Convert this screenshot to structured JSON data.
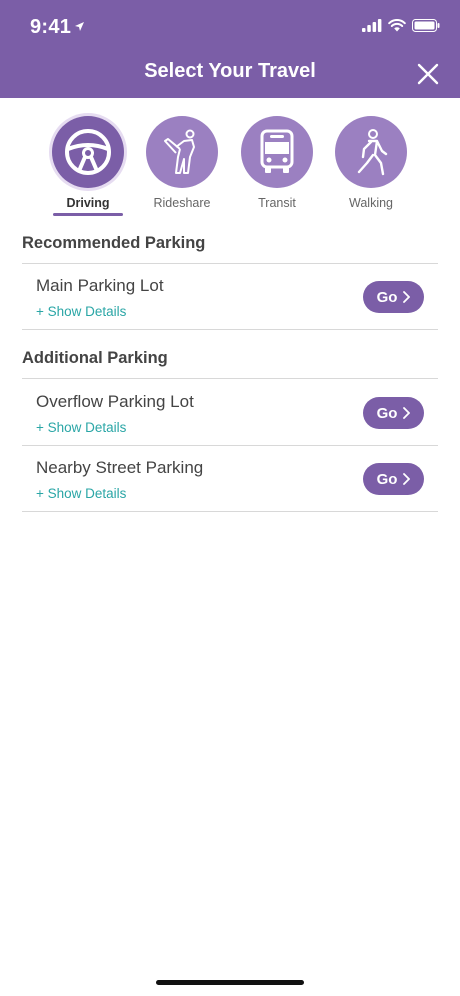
{
  "status_bar": {
    "time": "9:41"
  },
  "header": {
    "title": "Select Your Travel"
  },
  "modes": [
    {
      "label": "Driving",
      "icon": "steering-wheel-icon",
      "active": true
    },
    {
      "label": "Rideshare",
      "icon": "hailing-person-icon",
      "active": false
    },
    {
      "label": "Transit",
      "icon": "bus-icon",
      "active": false
    },
    {
      "label": "Walking",
      "icon": "walking-person-icon",
      "active": false
    }
  ],
  "recommended": {
    "title": "Recommended Parking",
    "items": [
      {
        "name": "Main Parking Lot",
        "details": "+ Show Details",
        "go": "Go"
      }
    ]
  },
  "additional": {
    "title": "Additional Parking",
    "items": [
      {
        "name": "Overflow Parking Lot",
        "details": "+ Show Details",
        "go": "Go"
      },
      {
        "name": "Nearby Street Parking",
        "details": "+ Show Details",
        "go": "Go"
      }
    ]
  },
  "colors": {
    "brand": "#7b5ea7",
    "brand_light": "#9b80c1",
    "link": "#2aa6a6"
  }
}
